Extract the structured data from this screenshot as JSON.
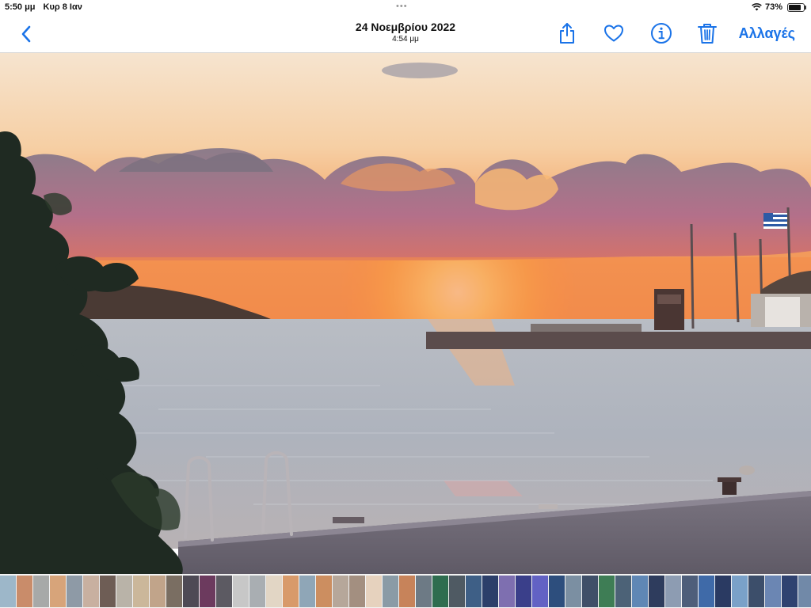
{
  "status_bar": {
    "time": "5:50 μμ",
    "date": "Κυρ 8 Ιαν",
    "battery_label": "73%",
    "battery_level": 0.73
  },
  "nav": {
    "back_icon": "chevron-left-icon",
    "title_date": "24 Νοεμβρίου 2022",
    "title_time": "4:54 μμ",
    "edit_label": "Αλλαγές",
    "accent_color": "#1a73e8",
    "action_icons": [
      "share-icon",
      "heart-icon",
      "info-icon",
      "trash-icon"
    ]
  },
  "photo": {
    "subject": "sunset-over-sea"
  },
  "thumbnails": {
    "colors": [
      "#9db7c9",
      "#c98c6a",
      "#a7a9a8",
      "#d7a47a",
      "#8e9aa6",
      "#c8b0a0",
      "#6e5d55",
      "#b9b3a8",
      "#cbb79a",
      "#c1a48a",
      "#7a6e62",
      "#4e4a55",
      "#6c3a5e",
      "#5c5a62",
      "#c7c7c7",
      "#a9aeb2",
      "#e2d6c5",
      "#d89a6a",
      "#8fa6b7",
      "#cc8e60",
      "#b6a79a",
      "#a38f80",
      "#e6d2be",
      "#8a9ba6",
      "#c7835a",
      "#6d7a85",
      "#2e6d4f",
      "#4f5a63",
      "#3e5f86",
      "#2c3f6a",
      "#7e6fb0",
      "#3a3f8a",
      "#6262c4",
      "#2d4e7d",
      "#7b8fa2",
      "#3f4f68",
      "#3e7d55",
      "#4c6277",
      "#5f87b5",
      "#2e3c5d",
      "#8d9cb2",
      "#4e5e7a",
      "#3f6aa8",
      "#2a3a62",
      "#7aa1c8",
      "#3c4e6a",
      "#6b86b3",
      "#2f4270",
      "#7189a8",
      "#40557a"
    ]
  }
}
